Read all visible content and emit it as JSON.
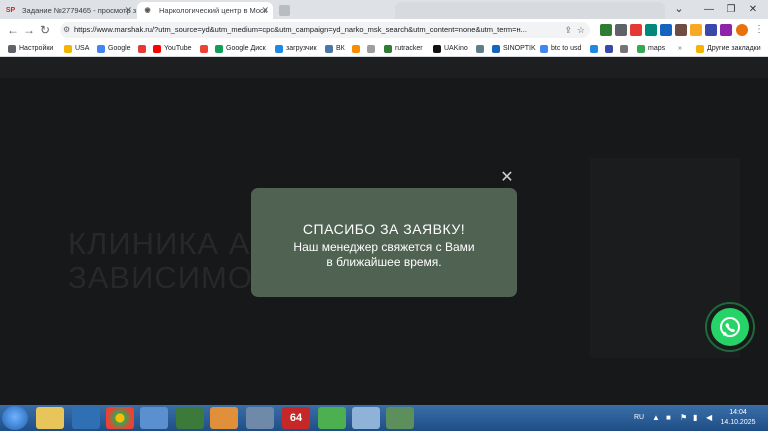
{
  "browser": {
    "tabs": [
      {
        "icon_text": "SP",
        "label": "Задание №2779465 - просмотр з",
        "active": false
      },
      {
        "icon_text": "◉",
        "label": "Наркологический центр в Моск",
        "active": true
      },
      {
        "icon_text": "",
        "label": "",
        "active": false
      }
    ],
    "url": "https://www.marshak.ru/?utm_source=yd&utm_medium=cpc&utm_campaign=yd_narko_msk_search&utm_content=none&utm_term=н..."
  },
  "bookmarks": [
    {
      "label": "Настройки",
      "color": "#5f6368",
      "icon": "gear-icon"
    },
    {
      "label": "USA",
      "color": "#f4b400",
      "icon": "folder-icon"
    },
    {
      "label": "Google",
      "color": "#4285f4",
      "icon": "google-icon"
    },
    {
      "label": "",
      "color": "#e53935",
      "icon": "yandex-icon"
    },
    {
      "label": "YouTube",
      "color": "#ff0000",
      "icon": "youtube-icon"
    },
    {
      "label": "",
      "color": "#ea4335",
      "icon": "gmail-icon"
    },
    {
      "label": "Google Диск",
      "color": "#0f9d58",
      "icon": "drive-icon"
    },
    {
      "label": "загрузчик",
      "color": "#1e88e5",
      "icon": "downloader-icon"
    },
    {
      "label": "ВК",
      "color": "#4a76a8",
      "icon": "vk-icon"
    },
    {
      "label": "",
      "color": "#fb8c00",
      "icon": "bookmark-icon"
    },
    {
      "label": "",
      "color": "#9e9e9e",
      "icon": "bookmark-icon"
    },
    {
      "label": "rutracker",
      "color": "#2e7d32",
      "icon": "rutracker-icon"
    },
    {
      "label": "UAKino",
      "color": "#111111",
      "icon": "uakino-icon"
    },
    {
      "label": "",
      "color": "#607d8b",
      "icon": "bookmark-icon"
    },
    {
      "label": "SINOPTIK",
      "color": "#1565c0",
      "icon": "sinoptik-icon"
    },
    {
      "label": "btc to usd",
      "color": "#4285f4",
      "icon": "google-icon"
    },
    {
      "label": "",
      "color": "#1e88e5",
      "icon": "bookmark-icon"
    },
    {
      "label": "",
      "color": "#3949ab",
      "icon": "bookmark-icon"
    },
    {
      "label": "",
      "color": "#757575",
      "icon": "bookmark-icon"
    },
    {
      "label": "maps",
      "color": "#34a853",
      "icon": "maps-icon"
    },
    {
      "label": "Другие закладки",
      "color": "#f4b400",
      "icon": "folder-icon"
    }
  ],
  "page": {
    "bg_heading_1": "КЛИНИКА А",
    "bg_heading_2": "ЗАВИСИМО"
  },
  "modal": {
    "title": "СПАСИБО ЗА ЗАЯВКУ!",
    "line1": "Наш менеджер свяжется с Вами",
    "line2": "в ближайшее время.",
    "bg_color": "#506252"
  },
  "taskbar": {
    "lang": "RU",
    "time": "14:04",
    "date": "14.10.2025"
  }
}
